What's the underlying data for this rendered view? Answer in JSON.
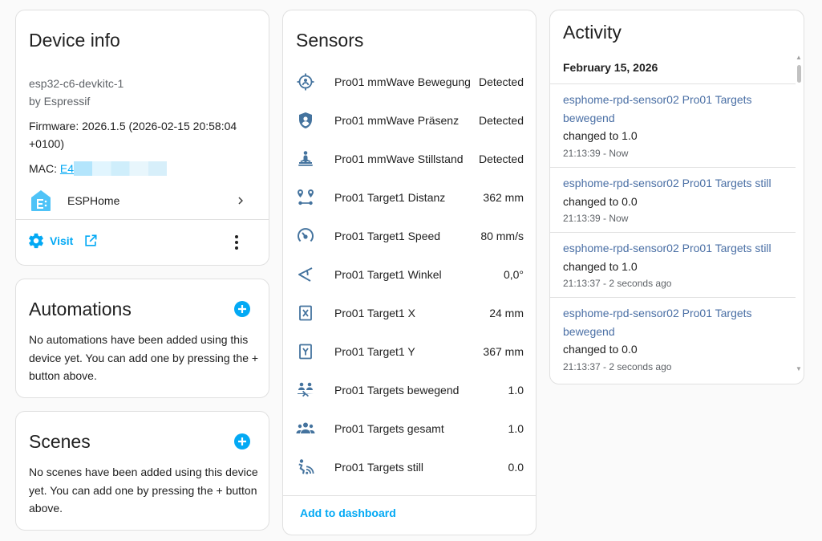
{
  "device": {
    "title": "Device info",
    "model": "esp32-c6-devkitc-1",
    "manufacturer": "by Espressif",
    "firmware": "Firmware: 2026.1.5 (2026-02-15 20:58:04 +0100)",
    "mac_label": "MAC: ",
    "mac_value": "E4",
    "integration": "ESPHome",
    "visit_label": "Visit"
  },
  "automations": {
    "title": "Automations",
    "description": "No automations have been added using this device yet. You can add one by pressing the + button above."
  },
  "scenes": {
    "title": "Scenes",
    "description": "No scenes have been added using this device yet. You can add one by pressing the + button above."
  },
  "sensors": {
    "title": "Sensors",
    "items": [
      {
        "name": "Pro01 mmWave Bewegung",
        "value": "Detected",
        "icon": "motion-target-icon"
      },
      {
        "name": "Pro01 mmWave Präsenz",
        "value": "Detected",
        "icon": "shield-account-icon"
      },
      {
        "name": "Pro01 mmWave Stillstand",
        "value": "Detected",
        "icon": "meditation-icon"
      },
      {
        "name": "Pro01 Target1 Distanz",
        "value": "362 mm",
        "icon": "map-marker-distance-icon"
      },
      {
        "name": "Pro01 Target1 Speed",
        "value": "80 mm/s",
        "icon": "speedometer-icon"
      },
      {
        "name": "Pro01 Target1 Winkel",
        "value": "0,0°",
        "icon": "angle-acute-icon"
      },
      {
        "name": "Pro01 Target1 X",
        "value": "24 mm",
        "icon": "alpha-x-box-icon"
      },
      {
        "name": "Pro01 Target1 Y",
        "value": "367 mm",
        "icon": "alpha-y-box-icon"
      },
      {
        "name": "Pro01 Targets bewegend",
        "value": "1.0",
        "icon": "account-arrow-icon"
      },
      {
        "name": "Pro01 Targets gesamt",
        "value": "1.0",
        "icon": "account-group-icon"
      },
      {
        "name": "Pro01 Targets still",
        "value": "0.0",
        "icon": "account-still-icon"
      }
    ],
    "add_to_dashboard": "Add to dashboard"
  },
  "activity": {
    "title": "Activity",
    "date": "February 15, 2026",
    "entries": [
      {
        "name": "esphome-rpd-sensor02 Pro01 Targets bewegend",
        "change": "changed to 1.0",
        "time": "21:13:39 - Now"
      },
      {
        "name": "esphome-rpd-sensor02 Pro01 Targets still",
        "change": "changed to 0.0",
        "time": "21:13:39 - Now"
      },
      {
        "name": "esphome-rpd-sensor02 Pro01 Targets still",
        "change": "changed to 1.0",
        "time": "21:13:37 - 2 seconds ago"
      },
      {
        "name": "esphome-rpd-sensor02 Pro01 Targets bewegend",
        "change": "changed to 0.0",
        "time": "21:13:37 - 2 seconds ago"
      }
    ]
  },
  "colors": {
    "accent": "#03a9f4",
    "icon": "#44739e",
    "activity_link": "#4a6fa5"
  }
}
